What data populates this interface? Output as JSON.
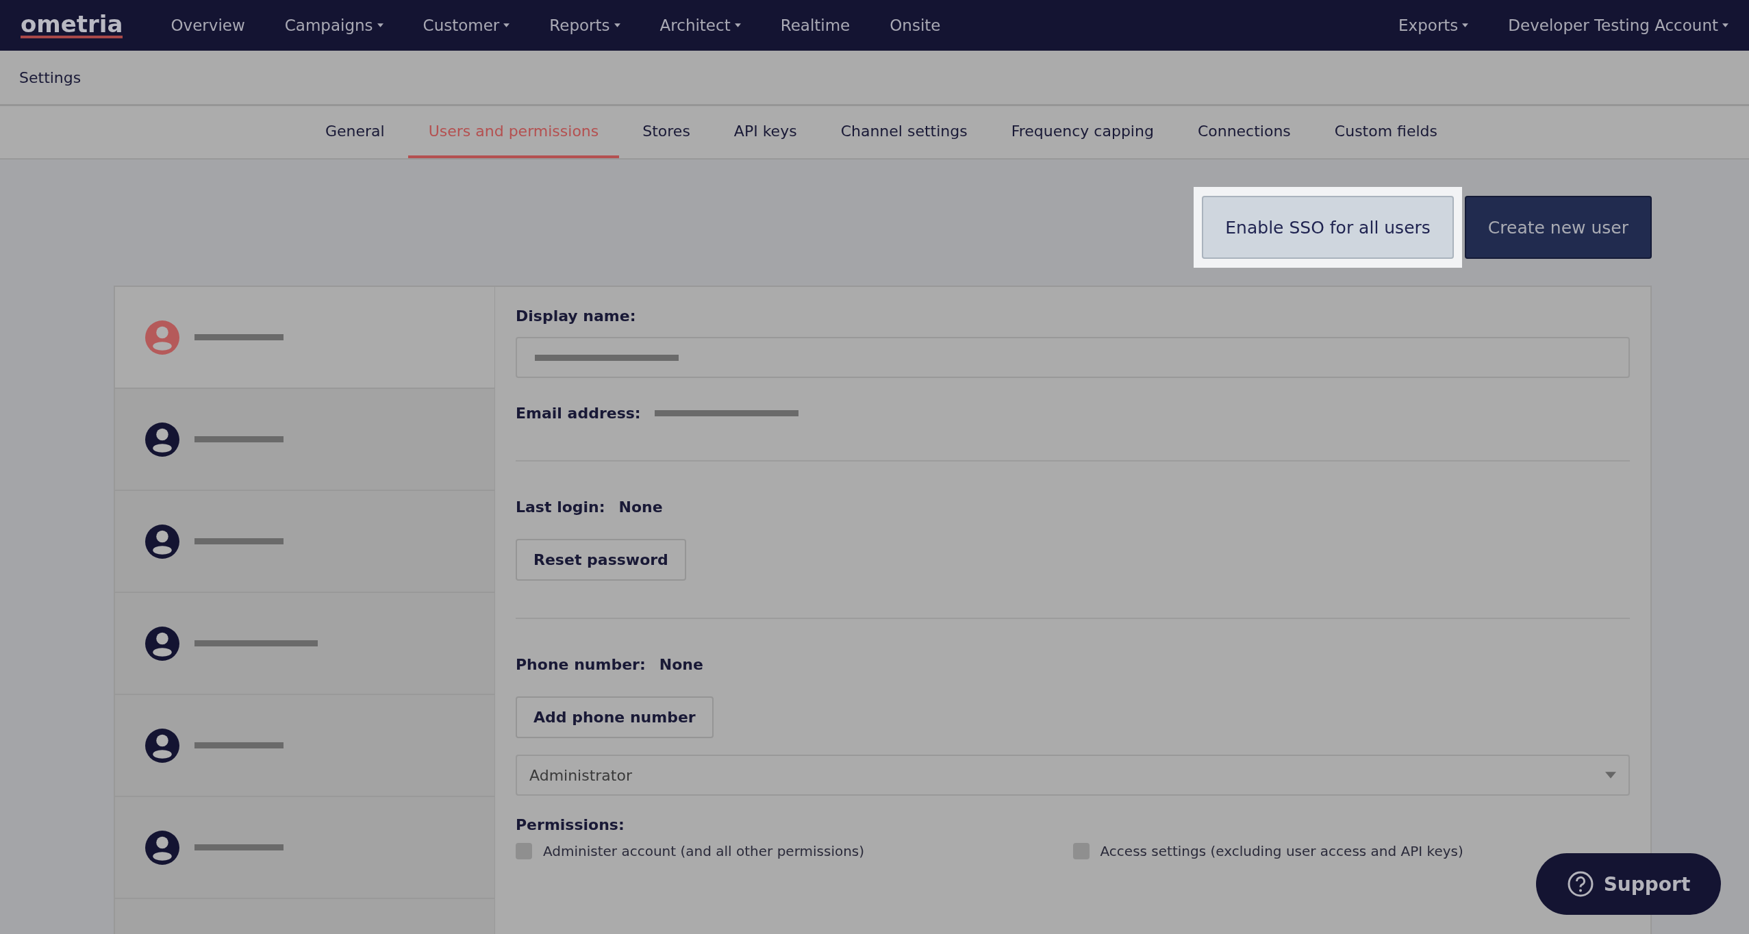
{
  "navbar": {
    "logo": "ometria",
    "items": [
      {
        "label": "Overview",
        "dropdown": false
      },
      {
        "label": "Campaigns",
        "dropdown": true
      },
      {
        "label": "Customer",
        "dropdown": true
      },
      {
        "label": "Reports",
        "dropdown": true
      },
      {
        "label": "Architect",
        "dropdown": true
      },
      {
        "label": "Realtime",
        "dropdown": false
      },
      {
        "label": "Onsite",
        "dropdown": false
      }
    ],
    "right_items": [
      {
        "label": "Exports",
        "dropdown": true
      },
      {
        "label": "Developer Testing Account",
        "dropdown": true
      }
    ]
  },
  "page_title": "Settings",
  "tabs": [
    {
      "label": "General",
      "selected": false
    },
    {
      "label": "Users and permissions",
      "selected": true
    },
    {
      "label": "Stores",
      "selected": false
    },
    {
      "label": "API keys",
      "selected": false
    },
    {
      "label": "Channel settings",
      "selected": false
    },
    {
      "label": "Frequency capping",
      "selected": false
    },
    {
      "label": "Connections",
      "selected": false
    },
    {
      "label": "Custom fields",
      "selected": false
    }
  ],
  "actions": [
    {
      "label": "Enable SSO for all users",
      "kind": "highlighted"
    },
    {
      "label": "Create new user",
      "kind": "primary"
    }
  ],
  "users": [
    {
      "selected": true,
      "redacted": true
    },
    {
      "selected": false,
      "redacted": true
    },
    {
      "selected": false,
      "redacted": true
    },
    {
      "selected": false,
      "redacted": true
    },
    {
      "selected": false,
      "redacted": true
    },
    {
      "selected": false,
      "redacted": true
    }
  ],
  "details": {
    "display_name_label": "Display name:",
    "display_name_redacted": true,
    "email_label": "Email address:",
    "email_redacted": true,
    "last_login_label": "Last login:",
    "last_login_value": "None",
    "reset_password_button": "Reset password",
    "phone_label": "Phone number:",
    "phone_value": "None",
    "add_phone_button": "Add phone number",
    "role": "Administrator",
    "permissions_label": "Permissions:",
    "permissions": [
      {
        "label": "Administer account (and all other permissions)",
        "checked": false
      },
      {
        "label": "Access settings (excluding user access and API keys)",
        "checked": false
      }
    ]
  },
  "support_button": "Support"
}
